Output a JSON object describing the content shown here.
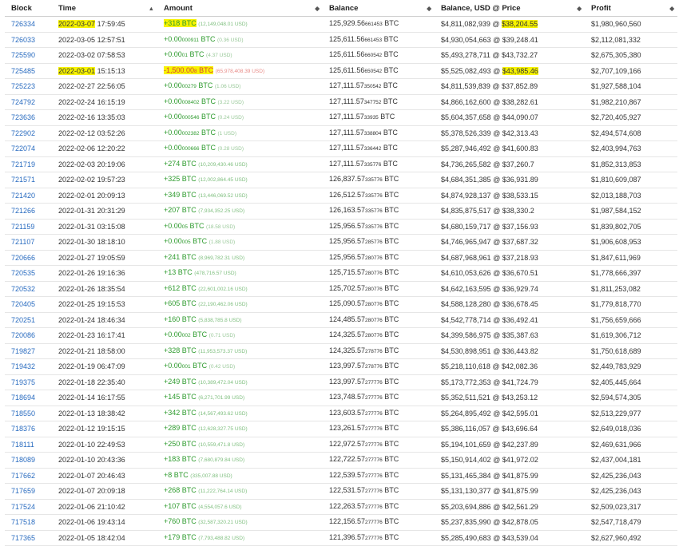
{
  "columns": [
    {
      "label": "Block",
      "sortable": true
    },
    {
      "label": "Time",
      "sortable": true
    },
    {
      "label": "Amount",
      "sortable": true
    },
    {
      "label": "Balance",
      "sortable": true
    },
    {
      "label": "Balance, USD @ Price",
      "sortable": true
    },
    {
      "label": "Profit",
      "sortable": true
    }
  ],
  "colors": {
    "link": "#2a6cc0",
    "positive": "#2e9b2e",
    "negative": "#d9403a",
    "highlight": "#f7f300"
  },
  "rows": [
    {
      "block": "726334",
      "date": "2022-03-07",
      "time": "17:59:45",
      "amount": "+318 BTC",
      "amount_small": "",
      "amount_usd": "(12,149,048.01 USD)",
      "sign": "pos",
      "bal_main": "125,929.56",
      "bal_small": "661453",
      "bal_unit": " BTC",
      "bal_usd": "$4,811,082,939",
      "price": "$38,204.55",
      "profit": "$1,980,960,560",
      "hl_date": true,
      "hl_amount": true,
      "hl_price": true
    },
    {
      "block": "726033",
      "date": "2022-03-05",
      "time": "12:57:51",
      "amount": "+0.00",
      "amount_small": "000911",
      "amount_usd": "(0.36 USD)",
      "sign": "zero",
      "bal_main": "125,611.56",
      "bal_small": "661453",
      "bal_unit": " BTC",
      "bal_usd": "$4,930,054,663",
      "price": "$39,248.41",
      "profit": "$2,112,081,332"
    },
    {
      "block": "725590",
      "date": "2022-03-02",
      "time": "07:58:53",
      "amount": "+0.00",
      "amount_small": "01",
      "amount_usd": "(4.37 USD)",
      "sign": "zero",
      "bal_main": "125,611.56",
      "bal_small": "660542",
      "bal_unit": " BTC",
      "bal_usd": "$5,493,278,711",
      "price": "$43,732.27",
      "profit": "$2,675,305,380"
    },
    {
      "block": "725485",
      "date": "2022-03-01",
      "time": "15:15:13",
      "amount": "-1,500.00",
      "amount_small": "8",
      "amount_usd": "(65,978,408.39 USD)",
      "sign": "neg",
      "bal_main": "125,611.56",
      "bal_small": "650542",
      "bal_unit": " BTC",
      "bal_usd": "$5,525,082,493",
      "price": "$43,985.46",
      "profit": "$2,707,109,166",
      "hl_date": true,
      "hl_amount": true,
      "hl_price": true
    },
    {
      "block": "725223",
      "date": "2022-02-27",
      "time": "22:56:05",
      "amount": "+0.00",
      "amount_small": "00279",
      "amount_usd": "(1.06 USD)",
      "sign": "zero",
      "bal_main": "127,111.57",
      "bal_small": "350542",
      "bal_unit": " BTC",
      "bal_usd": "$4,811,539,839",
      "price": "$37,852.89",
      "profit": "$1,927,588,104"
    },
    {
      "block": "724792",
      "date": "2022-02-24",
      "time": "16:15:19",
      "amount": "+0.00",
      "amount_small": "008402",
      "amount_usd": "(3.22 USD)",
      "sign": "zero",
      "bal_main": "127,111.57",
      "bal_small": "347752",
      "bal_unit": " BTC",
      "bal_usd": "$4,866,162,600",
      "price": "$38,282.61",
      "profit": "$1,982,210,867"
    },
    {
      "block": "723636",
      "date": "2022-02-16",
      "time": "13:35:03",
      "amount": "+0.00",
      "amount_small": "000546",
      "amount_usd": "(0.24 USD)",
      "sign": "zero",
      "bal_main": "127,111.57",
      "bal_small": "33935",
      "bal_unit": " BTC",
      "bal_usd": "$5,604,357,658",
      "price": "$44,090.07",
      "profit": "$2,720,405,927"
    },
    {
      "block": "722902",
      "date": "2022-02-12",
      "time": "03:52:26",
      "amount": "+0.00",
      "amount_small": "002382",
      "amount_usd": "(1 USD)",
      "sign": "zero",
      "bal_main": "127,111.57",
      "bal_small": "338804",
      "bal_unit": " BTC",
      "bal_usd": "$5,378,526,339",
      "price": "$42,313.43",
      "profit": "$2,494,574,608"
    },
    {
      "block": "722074",
      "date": "2022-02-06",
      "time": "12:20:22",
      "amount": "+0.00",
      "amount_small": "000666",
      "amount_usd": "(0.28 USD)",
      "sign": "zero",
      "bal_main": "127,111.57",
      "bal_small": "336442",
      "bal_unit": " BTC",
      "bal_usd": "$5,287,946,492",
      "price": "$41,600.83",
      "profit": "$2,403,994,763"
    },
    {
      "block": "721719",
      "date": "2022-02-03",
      "time": "20:19:06",
      "amount": "+274 BTC",
      "amount_small": "",
      "amount_usd": "(10,209,430.46 USD)",
      "sign": "pos",
      "bal_main": "127,111.57",
      "bal_small": "335776",
      "bal_unit": " BTC",
      "bal_usd": "$4,736,265,582",
      "price": "$37,260.7",
      "profit": "$1,852,313,853"
    },
    {
      "block": "721571",
      "date": "2022-02-02",
      "time": "19:57:23",
      "amount": "+325 BTC",
      "amount_small": "",
      "amount_usd": "(12,002,864.45 USD)",
      "sign": "pos",
      "bal_main": "126,837.57",
      "bal_small": "335776",
      "bal_unit": " BTC",
      "bal_usd": "$4,684,351,385",
      "price": "$36,931.89",
      "profit": "$1,810,609,087"
    },
    {
      "block": "721420",
      "date": "2022-02-01",
      "time": "20:09:13",
      "amount": "+349 BTC",
      "amount_small": "",
      "amount_usd": "(13,446,069.52 USD)",
      "sign": "pos",
      "bal_main": "126,512.57",
      "bal_small": "335776",
      "bal_unit": " BTC",
      "bal_usd": "$4,874,928,137",
      "price": "$38,533.15",
      "profit": "$2,013,188,703"
    },
    {
      "block": "721266",
      "date": "2022-01-31",
      "time": "20:31:29",
      "amount": "+207 BTC",
      "amount_small": "",
      "amount_usd": "(7,934,352.25 USD)",
      "sign": "pos",
      "bal_main": "126,163.57",
      "bal_small": "335776",
      "bal_unit": " BTC",
      "bal_usd": "$4,835,875,517",
      "price": "$38,330.2",
      "profit": "$1,987,584,152"
    },
    {
      "block": "721159",
      "date": "2022-01-31",
      "time": "03:15:08",
      "amount": "+0.00",
      "amount_small": "05",
      "amount_usd": "(18.58 USD)",
      "sign": "zero",
      "bal_main": "125,956.57",
      "bal_small": "335776",
      "bal_unit": " BTC",
      "bal_usd": "$4,680,159,717",
      "price": "$37,156.93",
      "profit": "$1,839,802,705"
    },
    {
      "block": "721107",
      "date": "2022-01-30",
      "time": "18:18:10",
      "amount": "+0.00",
      "amount_small": "005",
      "amount_usd": "(1.88 USD)",
      "sign": "zero",
      "bal_main": "125,956.57",
      "bal_small": "285776",
      "bal_unit": " BTC",
      "bal_usd": "$4,746,965,947",
      "price": "$37,687.32",
      "profit": "$1,906,608,953"
    },
    {
      "block": "720666",
      "date": "2022-01-27",
      "time": "19:05:59",
      "amount": "+241 BTC",
      "amount_small": "",
      "amount_usd": "(8,969,782.31 USD)",
      "sign": "pos",
      "bal_main": "125,956.57",
      "bal_small": "280776",
      "bal_unit": " BTC",
      "bal_usd": "$4,687,968,961",
      "price": "$37,218.93",
      "profit": "$1,847,611,969"
    },
    {
      "block": "720535",
      "date": "2022-01-26",
      "time": "19:16:36",
      "amount": "+13 BTC",
      "amount_small": "",
      "amount_usd": "(478,716.57 USD)",
      "sign": "pos",
      "bal_main": "125,715.57",
      "bal_small": "280776",
      "bal_unit": " BTC",
      "bal_usd": "$4,610,053,626",
      "price": "$36,670.51",
      "profit": "$1,778,666,397"
    },
    {
      "block": "720532",
      "date": "2022-01-26",
      "time": "18:35:54",
      "amount": "+612 BTC",
      "amount_small": "",
      "amount_usd": "(22,601,002.16 USD)",
      "sign": "pos",
      "bal_main": "125,702.57",
      "bal_small": "280776",
      "bal_unit": " BTC",
      "bal_usd": "$4,642,163,595",
      "price": "$36,929.74",
      "profit": "$1,811,253,082"
    },
    {
      "block": "720405",
      "date": "2022-01-25",
      "time": "19:15:53",
      "amount": "+605 BTC",
      "amount_small": "",
      "amount_usd": "(22,190,462.06 USD)",
      "sign": "pos",
      "bal_main": "125,090.57",
      "bal_small": "280776",
      "bal_unit": " BTC",
      "bal_usd": "$4,588,128,280",
      "price": "$36,678.45",
      "profit": "$1,779,818,770"
    },
    {
      "block": "720251",
      "date": "2022-01-24",
      "time": "18:46:34",
      "amount": "+160 BTC",
      "amount_small": "",
      "amount_usd": "(5,838,785.8 USD)",
      "sign": "pos",
      "bal_main": "124,485.57",
      "bal_small": "280776",
      "bal_unit": " BTC",
      "bal_usd": "$4,542,778,714",
      "price": "$36,492.41",
      "profit": "$1,756,659,666"
    },
    {
      "block": "720086",
      "date": "2022-01-23",
      "time": "16:17:41",
      "amount": "+0.00",
      "amount_small": "002",
      "amount_usd": "(0.71 USD)",
      "sign": "zero",
      "bal_main": "124,325.57",
      "bal_small": "280776",
      "bal_unit": " BTC",
      "bal_usd": "$4,399,586,975",
      "price": "$35,387.63",
      "profit": "$1,619,306,712"
    },
    {
      "block": "719827",
      "date": "2022-01-21",
      "time": "18:58:00",
      "amount": "+328 BTC",
      "amount_small": "",
      "amount_usd": "(11,953,573.37 USD)",
      "sign": "pos",
      "bal_main": "124,325.57",
      "bal_small": "278776",
      "bal_unit": " BTC",
      "bal_usd": "$4,530,898,951",
      "price": "$36,443.82",
      "profit": "$1,750,618,689"
    },
    {
      "block": "719432",
      "date": "2022-01-19",
      "time": "06:47:09",
      "amount": "+0.00",
      "amount_small": "001",
      "amount_usd": "(0.42 USD)",
      "sign": "zero",
      "bal_main": "123,997.57",
      "bal_small": "278776",
      "bal_unit": " BTC",
      "bal_usd": "$5,218,110,618",
      "price": "$42,082.36",
      "profit": "$2,449,783,929"
    },
    {
      "block": "719375",
      "date": "2022-01-18",
      "time": "22:35:40",
      "amount": "+249 BTC",
      "amount_small": "",
      "amount_usd": "(10,389,472.04 USD)",
      "sign": "pos",
      "bal_main": "123,997.57",
      "bal_small": "277776",
      "bal_unit": " BTC",
      "bal_usd": "$5,173,772,353",
      "price": "$41,724.79",
      "profit": "$2,405,445,664"
    },
    {
      "block": "718694",
      "date": "2022-01-14",
      "time": "16:17:55",
      "amount": "+145 BTC",
      "amount_small": "",
      "amount_usd": "(6,271,701.99 USD)",
      "sign": "pos",
      "bal_main": "123,748.57",
      "bal_small": "277776",
      "bal_unit": " BTC",
      "bal_usd": "$5,352,511,521",
      "price": "$43,253.12",
      "profit": "$2,594,574,305"
    },
    {
      "block": "718550",
      "date": "2022-01-13",
      "time": "18:38:42",
      "amount": "+342 BTC",
      "amount_small": "",
      "amount_usd": "(14,567,493.62 USD)",
      "sign": "pos",
      "bal_main": "123,603.57",
      "bal_small": "277776",
      "bal_unit": " BTC",
      "bal_usd": "$5,264,895,492",
      "price": "$42,595.01",
      "profit": "$2,513,229,977"
    },
    {
      "block": "718376",
      "date": "2022-01-12",
      "time": "19:15:15",
      "amount": "+289 BTC",
      "amount_small": "",
      "amount_usd": "(12,628,327.75 USD)",
      "sign": "pos",
      "bal_main": "123,261.57",
      "bal_small": "277776",
      "bal_unit": " BTC",
      "bal_usd": "$5,386,116,057",
      "price": "$43,696.64",
      "profit": "$2,649,018,036"
    },
    {
      "block": "718111",
      "date": "2022-01-10",
      "time": "22:49:53",
      "amount": "+250 BTC",
      "amount_small": "",
      "amount_usd": "(10,559,471.8 USD)",
      "sign": "pos",
      "bal_main": "122,972.57",
      "bal_small": "277776",
      "bal_unit": " BTC",
      "bal_usd": "$5,194,101,659",
      "price": "$42,237.89",
      "profit": "$2,469,631,966"
    },
    {
      "block": "718089",
      "date": "2022-01-10",
      "time": "20:43:36",
      "amount": "+183 BTC",
      "amount_small": "",
      "amount_usd": "(7,680,879.84 USD)",
      "sign": "pos",
      "bal_main": "122,722.57",
      "bal_small": "277776",
      "bal_unit": " BTC",
      "bal_usd": "$5,150,914,402",
      "price": "$41,972.02",
      "profit": "$2,437,004,181"
    },
    {
      "block": "717662",
      "date": "2022-01-07",
      "time": "20:46:43",
      "amount": "+8 BTC",
      "amount_small": "",
      "amount_usd": "(335,007.88 USD)",
      "sign": "pos",
      "bal_main": "122,539.57",
      "bal_small": "277776",
      "bal_unit": " BTC",
      "bal_usd": "$5,131,465,384",
      "price": "$41,875.99",
      "profit": "$2,425,236,043"
    },
    {
      "block": "717659",
      "date": "2022-01-07",
      "time": "20:09:18",
      "amount": "+268 BTC",
      "amount_small": "",
      "amount_usd": "(11,222,764.14 USD)",
      "sign": "pos",
      "bal_main": "122,531.57",
      "bal_small": "277776",
      "bal_unit": " BTC",
      "bal_usd": "$5,131,130,377",
      "price": "$41,875.99",
      "profit": "$2,425,236,043"
    },
    {
      "block": "717524",
      "date": "2022-01-06",
      "time": "21:10:42",
      "amount": "+107 BTC",
      "amount_small": "",
      "amount_usd": "(4,554,057.6 USD)",
      "sign": "pos",
      "bal_main": "122,263.57",
      "bal_small": "277776",
      "bal_unit": " BTC",
      "bal_usd": "$5,203,694,886",
      "price": "$42,561.29",
      "profit": "$2,509,023,317"
    },
    {
      "block": "717518",
      "date": "2022-01-06",
      "time": "19:43:14",
      "amount": "+760 BTC",
      "amount_small": "",
      "amount_usd": "(32,587,320.21 USD)",
      "sign": "pos",
      "bal_main": "122,156.57",
      "bal_small": "277776",
      "bal_unit": " BTC",
      "bal_usd": "$5,237,835,990",
      "price": "$42,878.05",
      "profit": "$2,547,718,479"
    },
    {
      "block": "717365",
      "date": "2022-01-05",
      "time": "18:42:04",
      "amount": "+179 BTC",
      "amount_small": "",
      "amount_usd": "(7,793,488.82 USD)",
      "sign": "pos",
      "bal_main": "121,396.57",
      "bal_small": "277776",
      "bal_unit": " BTC",
      "bal_usd": "$5,285,490,683",
      "price": "$43,539.04",
      "profit": "$2,627,960,492"
    }
  ]
}
